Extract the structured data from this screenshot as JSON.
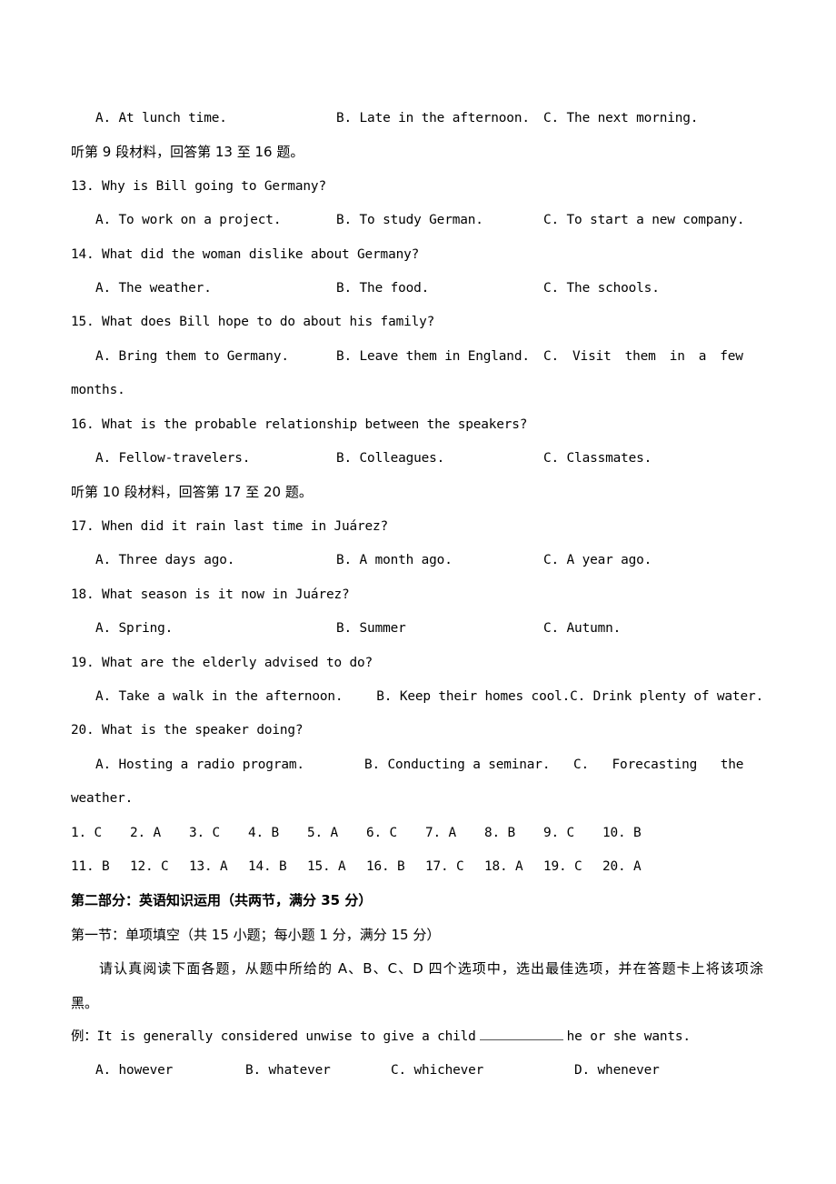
{
  "document": {
    "type": "exam-paper",
    "language": "zh-CN + en"
  },
  "listening": {
    "q12_options": {
      "a": "A. At lunch time.",
      "b": "B. Late in the afternoon.",
      "c": "C. The next morning."
    },
    "section9_header": "听第 9 段材料，回答第 13 至 16 题。",
    "section10_header": "听第 10 段材料，回答第 17 至 20 题。",
    "questions": [
      {
        "stem": "13. Why is Bill going to Germany?",
        "options": {
          "a": "A. To work on a project.",
          "b": "B. To study German.",
          "c": "C. To start a new company."
        }
      },
      {
        "stem": "14. What did the woman dislike about Germany?",
        "options": {
          "a": "A. The weather.",
          "b": "B. The food.",
          "c": "C. The schools."
        }
      },
      {
        "stem": "15. What does Bill hope to do about his family?",
        "options": {
          "a": "A. Bring them to Germany.",
          "b": "B. Leave them in England.",
          "c": "C. Visit them in a few",
          "c_continuation": "months."
        }
      },
      {
        "stem": "16. What is the probable relationship between the speakers?",
        "options": {
          "a": "A. Fellow-travelers.",
          "b": "B. Colleagues.",
          "c": "C. Classmates."
        }
      },
      {
        "stem": "17. When did it rain last time in Juárez?",
        "options": {
          "a": "A. Three days ago.",
          "b": "B. A month ago.",
          "c": "C. A year ago."
        }
      },
      {
        "stem": "18. What season is it now in Juárez?",
        "options": {
          "a": "A. Spring.",
          "b": "B. Summer",
          "c": "C. Autumn."
        }
      },
      {
        "stem": "19. What are the elderly advised to do?",
        "options": {
          "a": "A. Take a walk in the afternoon.",
          "b": "B. Keep their homes cool.",
          "c": "C. Drink plenty of water."
        }
      },
      {
        "stem": "20. What is the speaker doing?",
        "options": {
          "a": "A. Hosting a radio program.",
          "b": "B. Conducting a seminar.",
          "c": "C.    Forecasting    the",
          "c_continuation": "weather."
        }
      }
    ]
  },
  "answer_key": {
    "row1": [
      "1. C",
      "2. A",
      "3. C",
      "4. B",
      "5. A",
      "6. C",
      "7. A",
      "8. B",
      "9. C",
      "10. B"
    ],
    "row2": [
      "11. B",
      "12. C",
      "13. A",
      "14. B",
      "15. A",
      "16. B",
      "17. C",
      "18. A",
      "19. C",
      "20. A"
    ]
  },
  "part_two": {
    "heading": "第二部分：英语知识运用（共两节，满分 35 分）",
    "section_one_heading": "第一节：单项填空（共 15 小题；每小题 1 分，满分 15 分）",
    "instruction": "请认真阅读下面各题，从题中所给的 A、B、C、D 四个选项中，选出最佳选项，并在答题卡上将该项涂",
    "instruction_tail": "黑。",
    "example": {
      "prefix": "例：It is generally considered unwise to give a child",
      "suffix": "he or she wants.",
      "options": {
        "a": "A. however",
        "b": "B. whatever",
        "c": "C. whichever",
        "d": "D. whenever"
      }
    }
  }
}
